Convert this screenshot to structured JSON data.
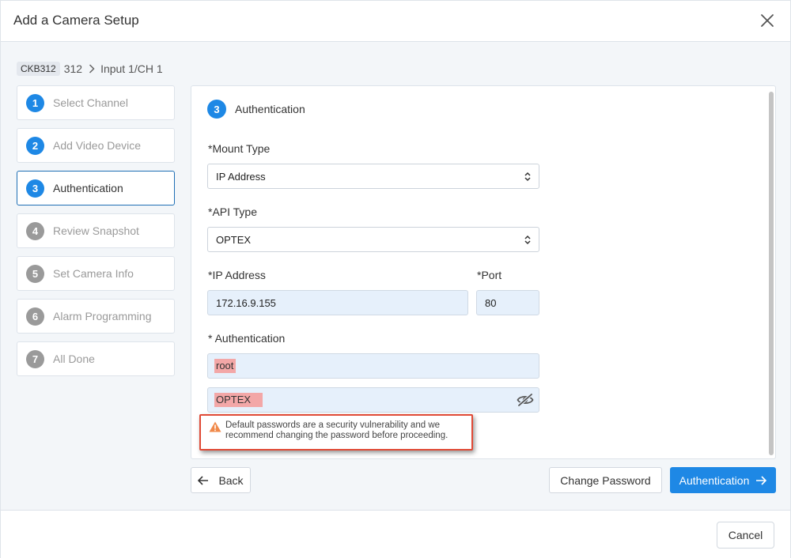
{
  "dialog": {
    "title": "Add a Camera Setup"
  },
  "breadcrumb": {
    "badge": "CKB312",
    "name": "312",
    "channel": "Input 1/CH 1"
  },
  "steps": [
    {
      "number": "1",
      "label": "Select Channel"
    },
    {
      "number": "2",
      "label": "Add Video Device"
    },
    {
      "number": "3",
      "label": "Authentication"
    },
    {
      "number": "4",
      "label": "Review Snapshot"
    },
    {
      "number": "5",
      "label": "Set Camera Info"
    },
    {
      "number": "6",
      "label": "Alarm Programming"
    },
    {
      "number": "7",
      "label": "All Done"
    }
  ],
  "panel": {
    "step_number": "3",
    "title": "Authentication",
    "mount_type": {
      "label": "*Mount Type",
      "value": "IP Address"
    },
    "api_type": {
      "label": "*API Type",
      "value": "OPTEX"
    },
    "ip_address": {
      "label": "*IP Address",
      "value": "172.16.9.155"
    },
    "port": {
      "label": "*Port",
      "value": "80"
    },
    "authentication": {
      "label": "* Authentication",
      "username": "root",
      "password": "OPTEX"
    },
    "warning": "Default passwords are a security vulnerability and we recommend changing the password before proceeding."
  },
  "actions": {
    "back": "Back",
    "change_password": "Change Password",
    "next": "Authentication"
  },
  "footer": {
    "cancel": "Cancel"
  },
  "colors": {
    "accent": "#1e88e5",
    "warning_border": "#e04a36",
    "warning_icon": "#f0894a",
    "highlight": "#f3a7a7"
  }
}
